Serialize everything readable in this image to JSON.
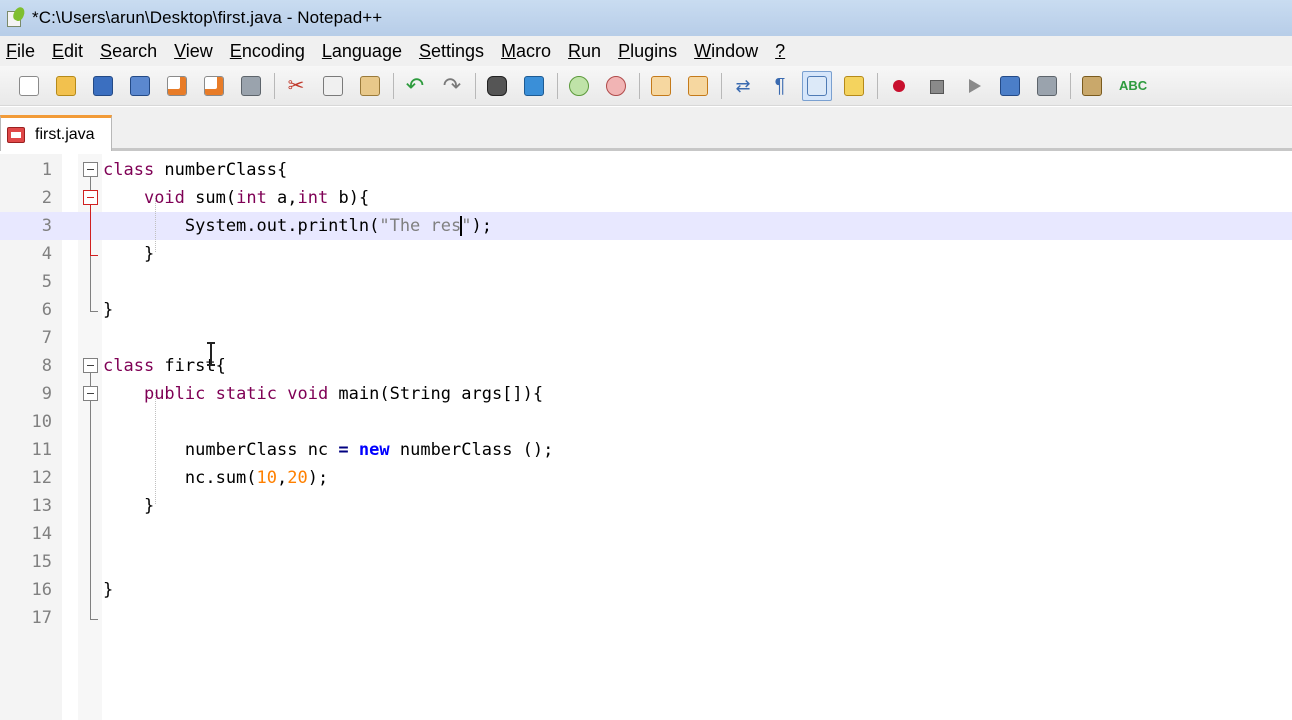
{
  "window": {
    "title": "*C:\\Users\\arun\\Desktop\\first.java - Notepad++"
  },
  "menu": [
    {
      "label": "File",
      "u": "F",
      "rest": "ile"
    },
    {
      "label": "Edit",
      "u": "E",
      "rest": "dit"
    },
    {
      "label": "Search",
      "u": "S",
      "rest": "earch"
    },
    {
      "label": "View",
      "u": "V",
      "rest": "iew"
    },
    {
      "label": "Encoding",
      "u": "E",
      "rest": "ncoding"
    },
    {
      "label": "Language",
      "u": "L",
      "rest": "anguage"
    },
    {
      "label": "Settings",
      "u": "S",
      "rest": "ettings"
    },
    {
      "label": "Macro",
      "u": "M",
      "rest": "acro"
    },
    {
      "label": "Run",
      "u": "R",
      "rest": "un"
    },
    {
      "label": "Plugins",
      "u": "P",
      "rest": "lugins"
    },
    {
      "label": "Window",
      "u": "W",
      "rest": "indow"
    },
    {
      "label": "?",
      "u": "?",
      "rest": ""
    }
  ],
  "tab": {
    "label": "first.java"
  },
  "editor": {
    "current_line": 3,
    "lines": [
      {
        "n": "1",
        "tokens": [
          {
            "t": "class",
            "c": "kw"
          },
          {
            "t": " numberClass{",
            "c": ""
          }
        ]
      },
      {
        "n": "2",
        "tokens": [
          {
            "t": "    ",
            "c": ""
          },
          {
            "t": "void",
            "c": "kw"
          },
          {
            "t": " sum(",
            "c": ""
          },
          {
            "t": "int",
            "c": "kw"
          },
          {
            "t": " a,",
            "c": ""
          },
          {
            "t": "int",
            "c": "kw"
          },
          {
            "t": " b){",
            "c": ""
          }
        ]
      },
      {
        "n": "3",
        "tokens": [
          {
            "t": "        System.out.println(",
            "c": ""
          },
          {
            "t": "\"The res",
            "c": "str"
          },
          {
            "t": "|",
            "c": "caret"
          },
          {
            "t": "\"",
            "c": "str"
          },
          {
            "t": ");",
            "c": ""
          }
        ]
      },
      {
        "n": "4",
        "tokens": [
          {
            "t": "    }",
            "c": ""
          }
        ]
      },
      {
        "n": "5",
        "tokens": []
      },
      {
        "n": "6",
        "tokens": [
          {
            "t": "}",
            "c": ""
          }
        ]
      },
      {
        "n": "7",
        "tokens": []
      },
      {
        "n": "8",
        "tokens": [
          {
            "t": "class",
            "c": "kw"
          },
          {
            "t": " first{",
            "c": ""
          }
        ]
      },
      {
        "n": "9",
        "tokens": [
          {
            "t": "    ",
            "c": ""
          },
          {
            "t": "public static void",
            "c": "kw"
          },
          {
            "t": " main(String args[]){",
            "c": ""
          }
        ]
      },
      {
        "n": "10",
        "tokens": []
      },
      {
        "n": "11",
        "tokens": [
          {
            "t": "        numberClass nc ",
            "c": ""
          },
          {
            "t": "=",
            "c": "op"
          },
          {
            "t": " ",
            "c": ""
          },
          {
            "t": "new",
            "c": "kw2"
          },
          {
            "t": " numberClass ();",
            "c": ""
          }
        ]
      },
      {
        "n": "12",
        "tokens": [
          {
            "t": "        nc.sum(",
            "c": ""
          },
          {
            "t": "10",
            "c": "num"
          },
          {
            "t": ",",
            "c": ""
          },
          {
            "t": "20",
            "c": "num"
          },
          {
            "t": ");",
            "c": ""
          }
        ]
      },
      {
        "n": "13",
        "tokens": [
          {
            "t": "    }",
            "c": ""
          }
        ]
      },
      {
        "n": "14",
        "tokens": []
      },
      {
        "n": "15",
        "tokens": []
      },
      {
        "n": "16",
        "tokens": [
          {
            "t": "}",
            "c": ""
          }
        ]
      },
      {
        "n": "17",
        "tokens": []
      }
    ]
  },
  "toolbar": {
    "icons": [
      "new-file-icon",
      "open-folder-icon",
      "save-icon",
      "save-all-icon",
      "close-file-icon",
      "close-all-icon",
      "print-icon",
      "sep",
      "cut-icon",
      "copy-icon",
      "paste-icon",
      "sep",
      "undo-icon",
      "redo-icon",
      "sep",
      "find-icon",
      "replace-icon",
      "sep",
      "zoom-in-icon",
      "zoom-out-icon",
      "sep",
      "sync-vertical-icon",
      "sync-horizontal-icon",
      "sep",
      "word-wrap-icon",
      "show-all-characters-icon",
      "indent-guide-icon",
      "user-language-icon",
      "sep",
      "record-macro-icon",
      "stop-macro-icon",
      "play-macro-icon",
      "play-macro-multiple-icon",
      "save-macro-icon",
      "sep",
      "run-icon",
      "spell-check-icon"
    ],
    "active": "indent-guide-icon"
  }
}
